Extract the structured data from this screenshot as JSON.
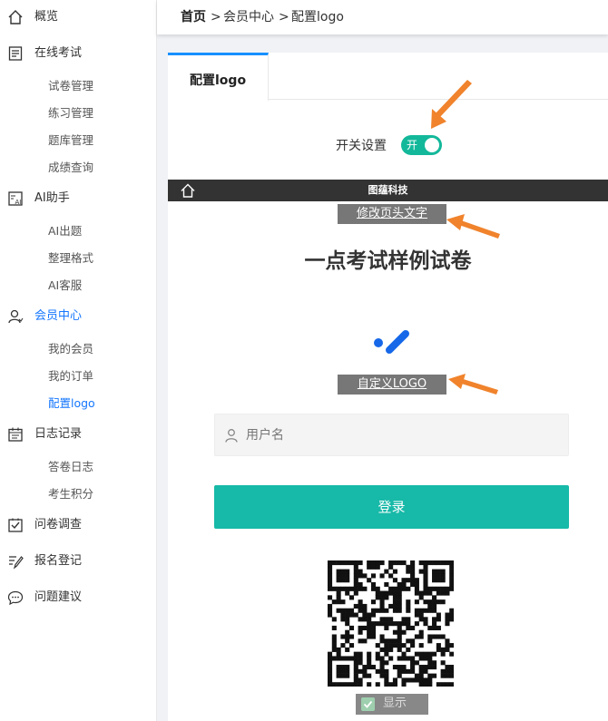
{
  "sidebar": {
    "groups": [
      {
        "label": "概览",
        "icon": "home-icon",
        "subs": []
      },
      {
        "label": "在线考试",
        "icon": "exam-list-icon",
        "subs": [
          "试卷管理",
          "练习管理",
          "题库管理",
          "成绩查询"
        ]
      },
      {
        "label": "AI助手",
        "icon": "ai-icon",
        "subs": [
          "AI出题",
          "整理格式",
          "AI客服"
        ]
      },
      {
        "label": "会员中心",
        "icon": "member-icon",
        "subs": [
          "我的会员",
          "我的订单",
          "配置logo"
        ]
      },
      {
        "label": "日志记录",
        "icon": "calendar-icon",
        "subs": [
          "答卷日志",
          "考生积分"
        ]
      },
      {
        "label": "问卷调查",
        "icon": "survey-check-icon",
        "subs": []
      },
      {
        "label": "报名登记",
        "icon": "register-pen-icon",
        "subs": []
      },
      {
        "label": "问题建议",
        "icon": "chat-bubble-icon",
        "subs": []
      }
    ],
    "active_group": "会员中心",
    "active_sub": "配置logo"
  },
  "breadcrumb": {
    "home": "首页",
    "sep": ">",
    "level2": "会员中心",
    "level3": "配置logo"
  },
  "tab": {
    "label": "配置logo"
  },
  "switch": {
    "label": "开关设置",
    "state_text": "开",
    "on": true
  },
  "preview": {
    "header_brand": "图蕴科技",
    "edit_header_btn": "修改页头文字",
    "exam_title": "一点考试样例试卷",
    "custom_logo_btn": "自定义LOGO",
    "username_placeholder": "用户名",
    "login_btn": "登录",
    "show_label": "显示",
    "show_checked": true
  },
  "colors": {
    "accent_blue": "#1677ff",
    "switch_green": "#13b89a",
    "login_teal": "#17b9a8",
    "arrow_orange": "#f0832c",
    "dark_bar": "#333333"
  }
}
